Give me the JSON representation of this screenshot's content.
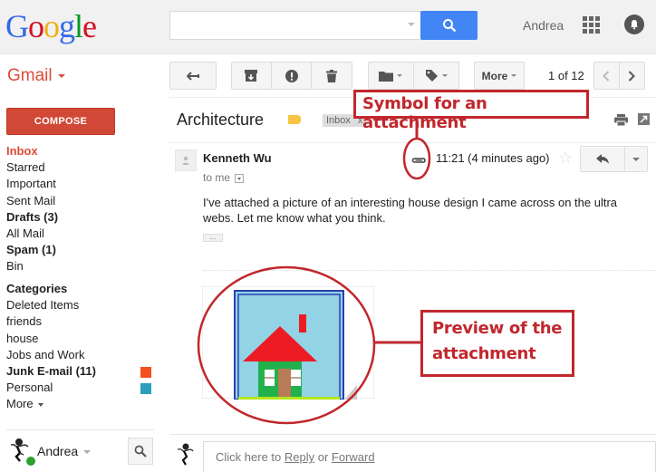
{
  "header": {
    "logo_letters": [
      "G",
      "o",
      "o",
      "g",
      "l",
      "e"
    ],
    "search_value": "",
    "user_name": "Andrea",
    "icons": [
      "search-icon",
      "apps-grid-icon",
      "notifications-bell-icon"
    ]
  },
  "app": {
    "name": "Gmail"
  },
  "toolbar": {
    "back_icon": "arrow-back-icon",
    "archive_icon": "archive-icon",
    "report_spam_icon": "report-spam-icon",
    "delete_icon": "trash-icon",
    "move_icon": "folder-icon",
    "labels_icon": "label-tag-icon",
    "more_label": "More",
    "pager": "1 of 12",
    "prev_icon": "chevron-left-icon",
    "next_icon": "chevron-right-icon"
  },
  "sidebar": {
    "compose_label": "COMPOSE",
    "items": [
      {
        "label": "Inbox",
        "style": "active"
      },
      {
        "label": "Starred",
        "style": "normal"
      },
      {
        "label": "Important",
        "style": "normal"
      },
      {
        "label": "Sent Mail",
        "style": "normal"
      },
      {
        "label": "Drafts (3)",
        "style": "bold"
      },
      {
        "label": "All Mail",
        "style": "normal"
      },
      {
        "label": "Spam (1)",
        "style": "bold"
      },
      {
        "label": "Bin",
        "style": "normal"
      }
    ],
    "categories_heading": "Categories",
    "categories": [
      {
        "label": "Deleted Items",
        "style": "normal",
        "color": ""
      },
      {
        "label": "friends",
        "style": "normal",
        "color": ""
      },
      {
        "label": "house",
        "style": "normal",
        "color": ""
      },
      {
        "label": "Jobs and Work",
        "style": "normal",
        "color": ""
      },
      {
        "label": "Junk E-mail (11)",
        "style": "bold",
        "color": "#f4511e"
      },
      {
        "label": "Personal",
        "style": "normal",
        "color": "#2a9fbc"
      }
    ],
    "more_label": "More",
    "chat_user": "Andrea",
    "chat_status_color": "#2ca02c"
  },
  "thread": {
    "subject": "Architecture",
    "label_color": "#f6c342",
    "inbox_chip": "Inbox",
    "inbox_chip_remove": "x",
    "message": {
      "sender": "Kenneth Wu",
      "recipient": "to me",
      "time": "11:21 (4 minutes ago)",
      "has_attachment": true,
      "body": "I've attached a picture of an interesting house design I came across on the ultra webs. Let me know what you think.",
      "ellipsis": "..."
    },
    "reply_prompt_prefix": "Click here to ",
    "reply_link": "Reply",
    "reply_or": " or ",
    "forward_link": "Forward"
  },
  "annotations": {
    "attachment_symbol": "Symbol for an attachment",
    "attachment_preview_line1": "Preview of the",
    "attachment_preview_line2": "attachment",
    "color": "#c1272d"
  }
}
